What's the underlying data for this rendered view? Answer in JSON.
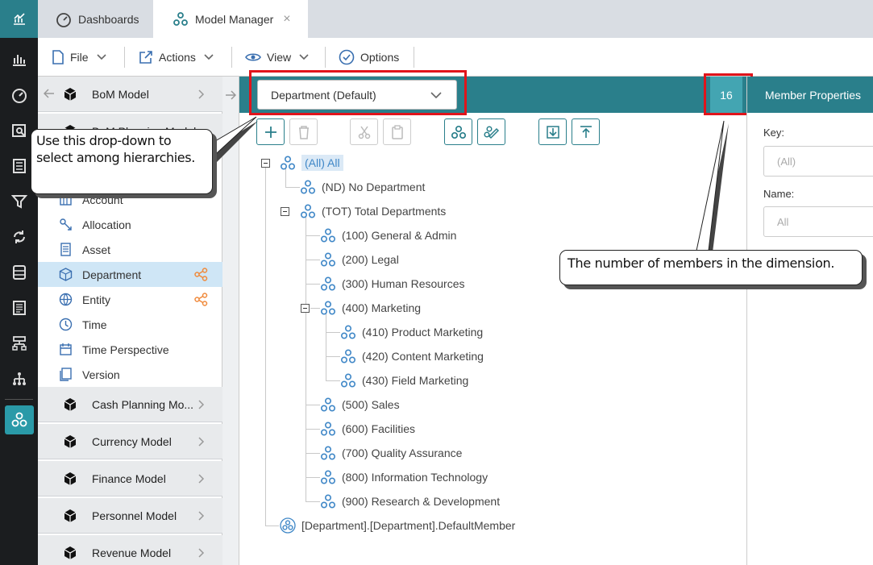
{
  "tabs": {
    "dashboards": "Dashboards",
    "model_manager": "Model Manager",
    "close": "×"
  },
  "toolbar": {
    "file": "File",
    "actions": "Actions",
    "view": "View",
    "options": "Options"
  },
  "models": [
    {
      "name": "BoM Model"
    },
    {
      "name": "Cash Planning Mo..."
    },
    {
      "name": "Currency Model"
    },
    {
      "name": "Finance Model"
    },
    {
      "name": "Personnel Model"
    },
    {
      "name": "Revenue Model"
    }
  ],
  "obscured_model_label": "BoM Planning Model",
  "dimensions": [
    {
      "name": "Account",
      "icon": "account-icon"
    },
    {
      "name": "Allocation",
      "icon": "allocation-icon"
    },
    {
      "name": "Asset",
      "icon": "asset-icon"
    },
    {
      "name": "Department",
      "icon": "department-icon",
      "selected": true
    },
    {
      "name": "Entity",
      "icon": "entity-icon"
    },
    {
      "name": "Time",
      "icon": "time-icon"
    },
    {
      "name": "Time Perspective",
      "icon": "calendar-icon"
    },
    {
      "name": "Version",
      "icon": "version-icon"
    }
  ],
  "hierarchy": {
    "selected": "Department (Default)",
    "member_count": "16"
  },
  "tree": [
    {
      "label": "(All) All"
    },
    {
      "label": "(ND) No Department"
    },
    {
      "label": "(TOT) Total Departments"
    },
    {
      "label": "(100) General & Admin"
    },
    {
      "label": "(200) Legal"
    },
    {
      "label": "(300) Human Resources"
    },
    {
      "label": "(400) Marketing"
    },
    {
      "label": "(410) Product Marketing"
    },
    {
      "label": "(420) Content Marketing"
    },
    {
      "label": "(430) Field Marketing"
    },
    {
      "label": "(500) Sales"
    },
    {
      "label": "(600) Facilities"
    },
    {
      "label": "(700) Quality Assurance"
    },
    {
      "label": "(800) Information Technology"
    },
    {
      "label": "(900) Research & Development"
    },
    {
      "label": "[Department].[Department].DefaultMember"
    }
  ],
  "properties": {
    "title": "Member Properties",
    "key_label": "Key:",
    "key_value": "(All)",
    "name_label": "Name:",
    "name_value": "All"
  },
  "callouts": {
    "hierarchy": "Use this drop-down to select among hierarchies.",
    "count": "The number of members in the dimension."
  },
  "colors": {
    "accent": "#2a7f8b",
    "count_bg": "#43a5b2",
    "highlight": "#e0141b",
    "selection": "#cfe6f6",
    "share": "#f08a3c"
  }
}
